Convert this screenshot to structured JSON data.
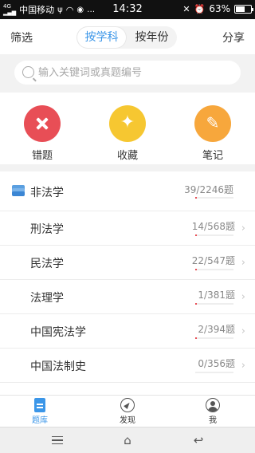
{
  "status_bar": {
    "carrier": "中国移动",
    "time": "14:32",
    "battery": "63%",
    "battery_level": 0.63
  },
  "topnav": {
    "filter_label": "筛选",
    "tabs": [
      {
        "label": "按学科",
        "active": true
      },
      {
        "label": "按年份",
        "active": false
      }
    ],
    "share_label": "分享"
  },
  "search": {
    "placeholder": "输入关键词或真题编号"
  },
  "quick_actions": [
    {
      "label": "错题",
      "icon": "close-icon",
      "color": "#e84e56"
    },
    {
      "label": "收藏",
      "icon": "star-icon",
      "color": "#f6c731"
    },
    {
      "label": "笔记",
      "icon": "pencil-icon",
      "color": "#f7a73c"
    }
  ],
  "category": {
    "title": "非法学",
    "count": "39/2246题",
    "progress": 0.017,
    "icon": "layers-icon"
  },
  "subjects": [
    {
      "title": "刑法学",
      "count": "14/568题",
      "progress": 0.025
    },
    {
      "title": "民法学",
      "count": "22/547题",
      "progress": 0.04
    },
    {
      "title": "法理学",
      "count": "1/381题",
      "progress": 0.003
    },
    {
      "title": "中国宪法学",
      "count": "2/394题",
      "progress": 0.005
    },
    {
      "title": "中国法制史",
      "count": "0/356题",
      "progress": 0.0
    }
  ],
  "tabbar": {
    "items": [
      {
        "label": "题库",
        "icon": "document-icon",
        "active": true
      },
      {
        "label": "发现",
        "icon": "compass-icon",
        "active": false
      },
      {
        "label": "我",
        "icon": "user-icon",
        "active": false
      }
    ]
  },
  "colors": {
    "accent": "#3b96e8",
    "progress": "#e84e56"
  }
}
